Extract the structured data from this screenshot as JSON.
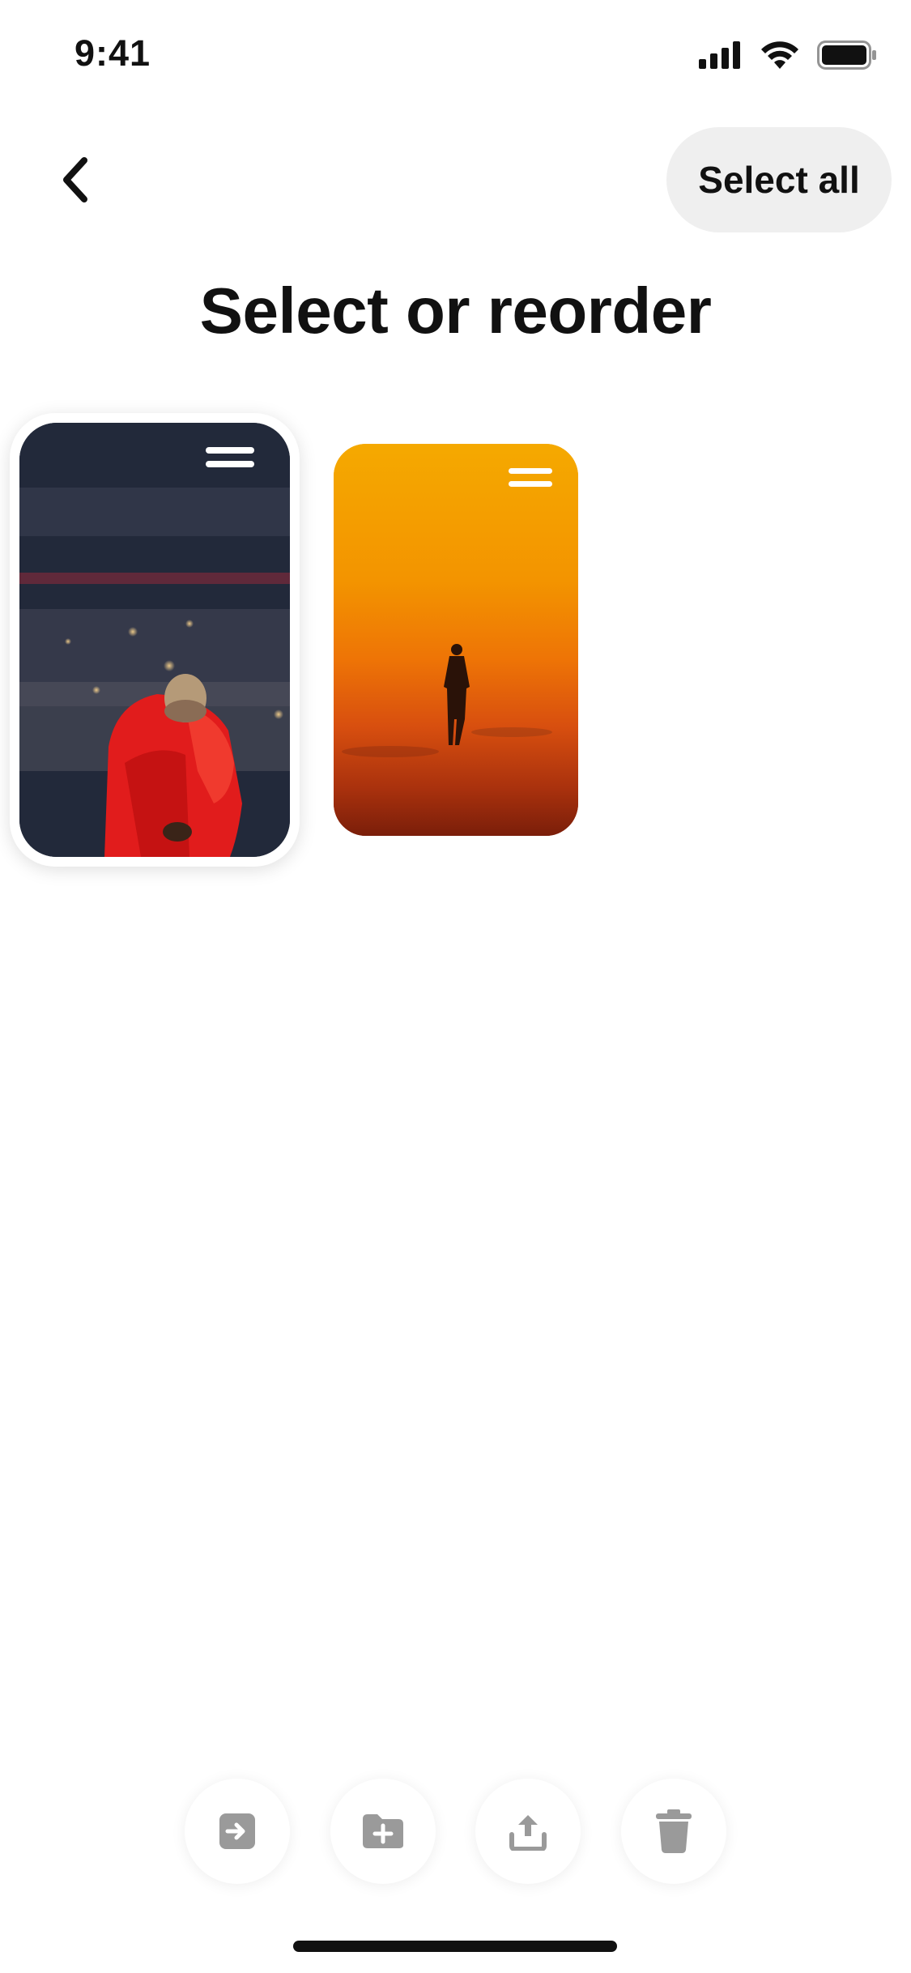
{
  "status_bar": {
    "time": "9:41",
    "icons": [
      "cellular-signal-icon",
      "wifi-icon",
      "battery-icon"
    ]
  },
  "header": {
    "back_icon": "chevron-left-icon",
    "select_all_label": "Select all"
  },
  "title": "Select or reorder",
  "cards": [
    {
      "image": "red puffer jacket performer in stadium",
      "selected": true,
      "handle_icon": "drag-handle-icon"
    },
    {
      "image": "silhouette walking in orange haze",
      "selected": false,
      "handle_icon": "drag-handle-icon"
    }
  ],
  "toolbar": {
    "buttons": [
      {
        "icon": "move-to-board-icon"
      },
      {
        "icon": "new-folder-icon"
      },
      {
        "icon": "share-icon"
      },
      {
        "icon": "trash-icon"
      }
    ],
    "enabled": false
  },
  "colors": {
    "accent": "#111111",
    "pill_bg": "#efefef",
    "disabled_icon": "#9a9a9a"
  }
}
